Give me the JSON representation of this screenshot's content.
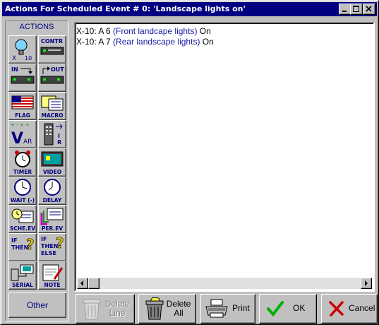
{
  "window": {
    "title": "Actions For Scheduled Event # 0: 'Landscape lights on'",
    "controls": [
      "minimize-icon",
      "maximize-icon",
      "close-icon"
    ]
  },
  "sidebar": {
    "heading": "ACTIONS",
    "tools": [
      {
        "label": "X-10",
        "icon": "x10-bulb-icon"
      },
      {
        "label": "CONTR",
        "icon": "controller-icon"
      },
      {
        "label": "IN",
        "icon": "input-module-icon"
      },
      {
        "label": "OUT",
        "icon": "output-module-icon"
      },
      {
        "label": "FLAG",
        "icon": "flag-icon"
      },
      {
        "label": "MACRO",
        "icon": "macro-icon"
      },
      {
        "label": "VAR",
        "icon": "variable-icon"
      },
      {
        "label": "IR",
        "icon": "ir-remote-icon"
      },
      {
        "label": "TIMER",
        "icon": "timer-icon"
      },
      {
        "label": "VIDEO",
        "icon": "video-monitor-icon"
      },
      {
        "label": "WAIT (-)",
        "icon": "wait-clock-icon"
      },
      {
        "label": "DELAY",
        "icon": "delay-clock-icon"
      },
      {
        "label": "SCHE.EV",
        "icon": "scheduled-event-icon"
      },
      {
        "label": "PER.EV",
        "icon": "periodic-event-icon"
      },
      {
        "label": "IF THEN",
        "icon": "if-then-icon"
      },
      {
        "label": "IF THEN ELSE",
        "icon": "if-then-else-icon"
      },
      {
        "label": "SERIAL",
        "icon": "serial-port-icon"
      },
      {
        "label": "NOTE",
        "icon": "note-icon"
      }
    ],
    "other_label": "Other"
  },
  "actions": [
    {
      "prefix": "X-10: A 6 ",
      "device": "(Front landcape lights)",
      "command": " On"
    },
    {
      "prefix": "X-10: A 7 ",
      "device": "(Rear landscape lights)",
      "command": " On"
    }
  ],
  "buttons": {
    "delete_line": [
      "Delete",
      "Line"
    ],
    "delete_all": [
      "Delete",
      "All"
    ],
    "print": "Print",
    "ok": "OK",
    "cancel": "Cancel"
  },
  "colors": {
    "titlebar": "#000080",
    "device_text": "#1a1aa0",
    "face": "#c0c0c0"
  }
}
